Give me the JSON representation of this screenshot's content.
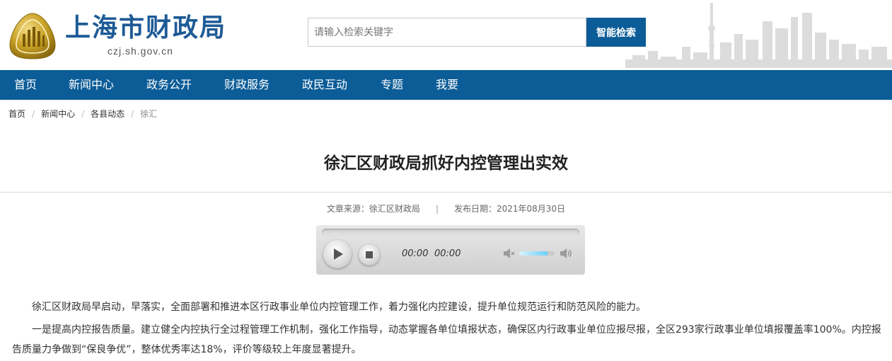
{
  "header": {
    "site_name": "上海市财政局",
    "domain": "czj.sh.gov.cn",
    "search_placeholder": "请输入检索关键字",
    "search_button": "智能检索"
  },
  "nav": {
    "items": [
      "首页",
      "新闻中心",
      "政务公开",
      "财政服务",
      "政民互动",
      "专题",
      "我要"
    ]
  },
  "breadcrumb": {
    "items": [
      "首页",
      "新闻中心",
      "各县动态",
      "徐汇"
    ],
    "separator": "/"
  },
  "article": {
    "title": "徐汇区财政局抓好内控管理出实效",
    "source_label": "文章来源：",
    "source": "徐汇区财政局",
    "meta_separator": "|",
    "date_label": "发布日期：",
    "date": "2021年08月30日",
    "paragraphs": [
      "徐汇区财政局早启动，早落实，全面部署和推进本区行政事业单位内控管理工作，着力强化内控建设，提升单位规范运行和防范风险的能力。",
      "一是提高内控报告质量。建立健全内控执行全过程管理工作机制，强化工作指导，动态掌握各单位填报状态，确保区内行政事业单位应报尽报，全区293家行政事业单位填报覆盖率100%。内控报告质量力争做到“保良争优”，整体优秀率达18%，评价等级较上年度显著提升。"
    ]
  },
  "player": {
    "current_time": "00:00",
    "duration": "00:00",
    "progress": 0,
    "volume": 0.8
  },
  "colors": {
    "brand_blue": "#0b5c97",
    "logo_gold": "#c9a227"
  },
  "icons": [
    "emblem-logo",
    "skyline-graphic",
    "play-icon",
    "stop-icon",
    "volume-mute-icon",
    "volume-up-icon"
  ]
}
